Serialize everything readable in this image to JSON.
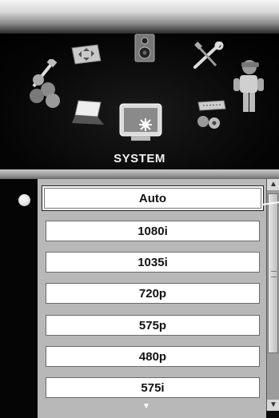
{
  "menu": {
    "category_label": "SYSTEM",
    "icons": [
      "picture-adjust-icon",
      "speaker-icon",
      "tools-icon",
      "color-balls-icon",
      "user-icon",
      "laptop-icon",
      "system-monitor-icon",
      "input-connector-icon"
    ]
  },
  "resolution_list": {
    "options": [
      {
        "label": "Auto",
        "selected": true
      },
      {
        "label": "1080i",
        "selected": false
      },
      {
        "label": "1035i",
        "selected": false
      },
      {
        "label": "720p",
        "selected": false
      },
      {
        "label": "575p",
        "selected": false
      },
      {
        "label": "480p",
        "selected": false
      },
      {
        "label": "575i",
        "selected": false
      }
    ],
    "more_indicator": "▼"
  },
  "scrollbar": {
    "up_arrow": "▲",
    "down_arrow": "▼"
  }
}
